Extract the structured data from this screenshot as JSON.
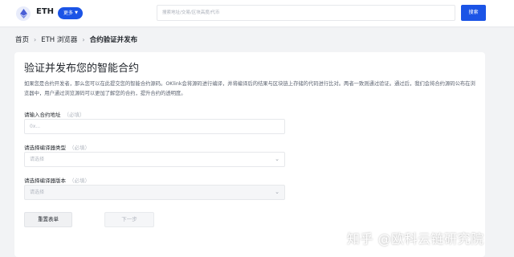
{
  "header": {
    "chain_name": "ETH",
    "more_label": "更多",
    "search_placeholder": "搜索地址/交易/区块高度/代币",
    "search_button": "搜索"
  },
  "breadcrumb": {
    "home": "首页",
    "explorer": "ETH 浏览器",
    "current": "合约验证并发布"
  },
  "card": {
    "title": "验证并发布您的智能合约",
    "description": "如果您是合约开发者，那么您可以在此提交您的智能合约源码。OKlink会将源码进行编译，并将编译后的结果与区块链上存储的代码进行比对。两者一致则通过验证。通过后，我们会将合约源码公布在浏览器中，用户通过浏览源码可以更加了解您的合约，提升合约的透明度。"
  },
  "form": {
    "address_label": "请输入合约地址",
    "address_required": "（必填）",
    "address_placeholder": "0x...",
    "compiler_type_label": "请选择编译器类型",
    "compiler_type_required": "（必填）",
    "compiler_type_placeholder": "请选择",
    "compiler_version_label": "请选择编译器版本",
    "compiler_version_required": "（必填）",
    "compiler_version_placeholder": "请选择",
    "reset_button": "重置表单",
    "next_button": "下一步"
  },
  "watermark": "知乎 @欧科云链研究院"
}
